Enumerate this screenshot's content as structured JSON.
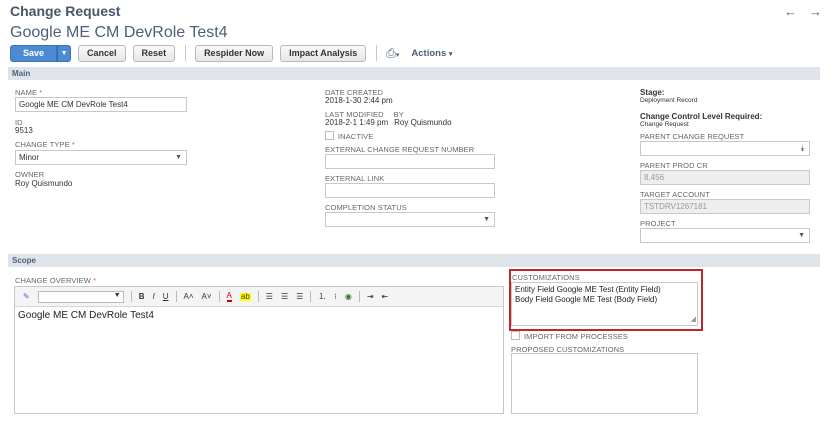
{
  "header": {
    "record_type": "Change Request",
    "record_title": "Google ME CM DevRole Test4",
    "prev_arrow": "←",
    "next_arrow": "→"
  },
  "toolbar": {
    "save": "Save",
    "cancel": "Cancel",
    "reset": "Reset",
    "respider": "Respider Now",
    "impact": "Impact Analysis",
    "actions": "Actions"
  },
  "sections": {
    "main": "Main",
    "scope": "Scope"
  },
  "main": {
    "name_label": "NAME",
    "name_value": "Google ME CM DevRole Test4",
    "id_label": "ID",
    "id_value": "9513",
    "change_type_label": "CHANGE TYPE",
    "change_type_value": "Minor",
    "owner_label": "OWNER",
    "owner_value": "Roy Quismundo",
    "date_created_label": "DATE CREATED",
    "date_created_value": "2018-1-30 2:44 pm",
    "last_modified_label": "LAST MODIFIED",
    "by_label": "BY",
    "last_modified_value": "2018-2-1 1:49 pm",
    "by_value": "Roy Quismundo",
    "inactive_label": "INACTIVE",
    "ext_cr_label": "EXTERNAL CHANGE REQUEST NUMBER",
    "ext_link_label": "EXTERNAL LINK",
    "completion_label": "COMPLETION STATUS",
    "stage_label": "Stage:",
    "stage_value": "Deployment Record",
    "ccl_label": "Change Control Level Required:",
    "ccl_value": "Change Request",
    "parent_cr_label": "PARENT CHANGE REQUEST",
    "parent_prod_label": "PARENT PROD CR",
    "parent_prod_value": "8,456",
    "target_account_label": "TARGET ACCOUNT",
    "target_account_value": "TSTDRV1267181",
    "project_label": "PROJECT"
  },
  "scope": {
    "overview_label": "CHANGE OVERVIEW",
    "overview_text": "Google ME CM DevRole Test4",
    "customizations_label": "CUSTOMIZATIONS",
    "customizations_line1": "Entity Field Google ME Test (Entity Field)",
    "customizations_line2": "Body Field Google ME Test (Body Field)",
    "import_label": "IMPORT FROM PROCESSES",
    "proposed_label": "PROPOSED CUSTOMIZATIONS"
  },
  "editor_toolbar": {
    "bold": "B",
    "italic": "I",
    "underline": "U",
    "font_up": "A˄",
    "font_down": "A˅",
    "text_color": "A",
    "highlight": "ab"
  },
  "colors": {
    "accent": "#4d8ad4",
    "highlight_border": "#c0272d",
    "section_bar": "#dfe4eb"
  }
}
